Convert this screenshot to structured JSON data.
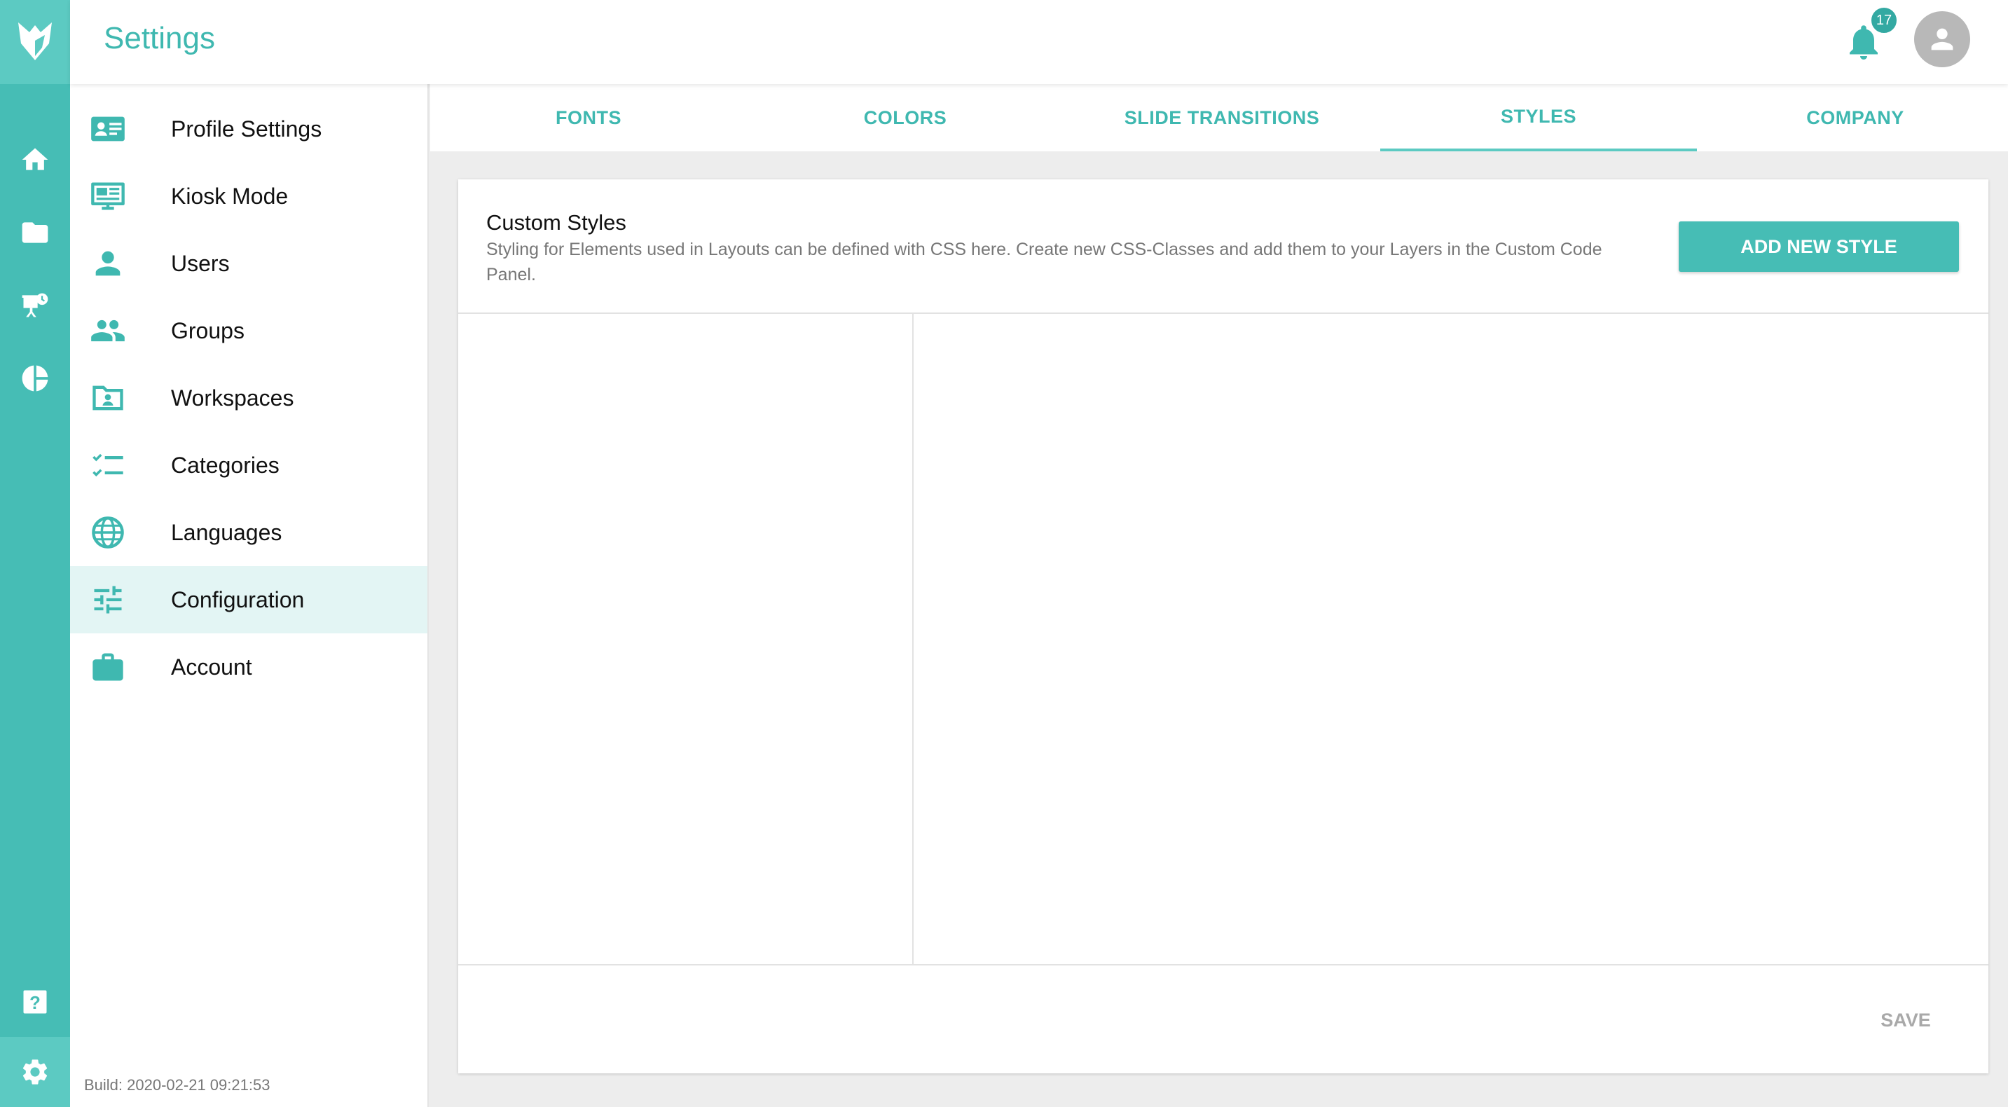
{
  "rail": {
    "logo": "fox-logo-icon",
    "items": [
      {
        "icon": "home-icon"
      },
      {
        "icon": "folder-icon"
      },
      {
        "icon": "presentation-icon"
      },
      {
        "icon": "pie-chart-icon"
      }
    ],
    "help_icon": "help-icon",
    "settings_icon": "gear-icon"
  },
  "header": {
    "title": "Settings",
    "notification_count": "17"
  },
  "sidebar": {
    "items": [
      {
        "label": "Profile Settings",
        "icon": "profile-card-icon"
      },
      {
        "label": "Kiosk Mode",
        "icon": "kiosk-icon"
      },
      {
        "label": "Users",
        "icon": "user-icon"
      },
      {
        "label": "Groups",
        "icon": "groups-icon"
      },
      {
        "label": "Workspaces",
        "icon": "workspace-folder-icon"
      },
      {
        "label": "Categories",
        "icon": "checklist-icon"
      },
      {
        "label": "Languages",
        "icon": "globe-icon"
      },
      {
        "label": "Configuration",
        "icon": "sliders-icon"
      },
      {
        "label": "Account",
        "icon": "briefcase-icon"
      }
    ],
    "active_item": "Configuration",
    "build": "Build: 2020-02-21 09:21:53"
  },
  "tabs": {
    "items": [
      "FONTS",
      "COLORS",
      "SLIDE TRANSITIONS",
      "STYLES",
      "COMPANY"
    ],
    "active": "STYLES"
  },
  "card": {
    "title": "Custom Styles",
    "description": "Styling for Elements used in Layouts can be defined with CSS here. Create new CSS-Classes and add them to your Layers in the Custom Code Panel.",
    "add_button": "ADD NEW STYLE",
    "save_button": "SAVE"
  },
  "colors": {
    "accent": "#46bdb5",
    "accent_light": "#5ccac2",
    "active_bg": "#e3f5f4"
  }
}
